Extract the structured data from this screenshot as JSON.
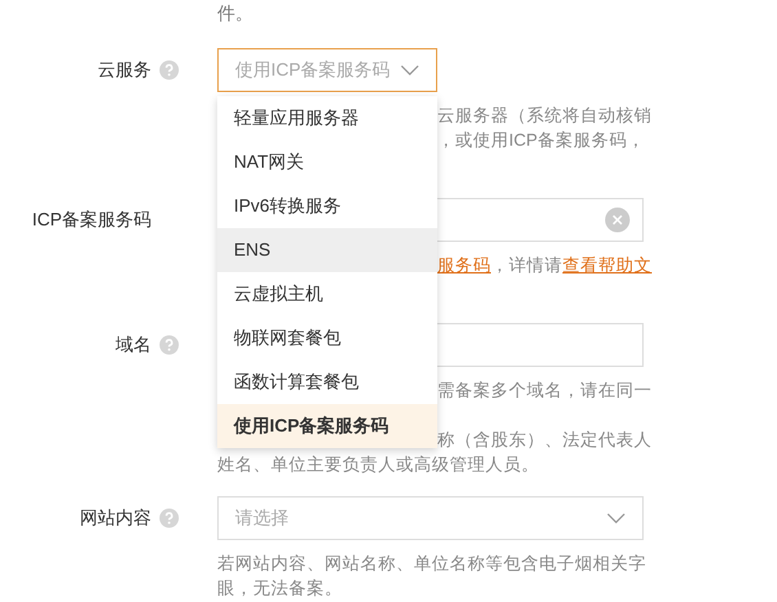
{
  "top_text": "件。",
  "fields": [
    {
      "label": "云服务",
      "help_icon": true,
      "kind": "select",
      "value": "使用ICP备案服务码",
      "open": true,
      "help_lines": [
        {
          "covered": true,
          "parts": [
            {
              "kind": "text",
              "text": "云服务器（系统将自动核销"
            }
          ]
        },
        {
          "covered": true,
          "parts": [
            {
              "kind": "text",
              "text": "，或使用ICP备案服务码，"
            }
          ]
        }
      ]
    },
    {
      "label": "ICP备案服务码",
      "help_icon": false,
      "kind": "input",
      "clearable": true,
      "help_lines": [
        {
          "covered": true,
          "parts": [
            {
              "kind": "link",
              "text": "服务码"
            },
            {
              "kind": "text",
              "text": "，详情请"
            },
            {
              "kind": "link",
              "text": "查看帮助文"
            }
          ]
        }
      ]
    },
    {
      "label": "域名",
      "help_icon": true,
      "kind": "input",
      "clearable": false,
      "help_lines": [
        {
          "covered": true,
          "parts": [
            {
              "kind": "text",
              "text": "需备案多个域名，请在同一"
            }
          ]
        },
        {
          "covered": true,
          "blank_before": true,
          "parts": [
            {
              "kind": "text",
              "text": "称（含股东）、法定代表人"
            }
          ]
        },
        {
          "parts": [
            {
              "kind": "text",
              "text": "姓名、单位主要负责人或高级管理人员。"
            }
          ]
        }
      ]
    },
    {
      "label": "网站内容",
      "help_icon": true,
      "kind": "select",
      "placeholder": "请选择",
      "open": false,
      "help_lines": [
        {
          "parts": [
            {
              "kind": "text",
              "text": "若网站内容、网站名称、单位名称等包含电子烟相关字"
            }
          ]
        },
        {
          "parts": [
            {
              "kind": "text",
              "text": "眼，无法备案。"
            }
          ]
        }
      ]
    }
  ],
  "dropdown": {
    "options": [
      {
        "label": "轻量应用服务器",
        "selected": false,
        "hovered": false
      },
      {
        "label": "NAT网关",
        "selected": false,
        "hovered": false
      },
      {
        "label": "IPv6转换服务",
        "selected": false,
        "hovered": false
      },
      {
        "label": "ENS",
        "selected": false,
        "hovered": true
      },
      {
        "label": "云虚拟主机",
        "selected": false,
        "hovered": false
      },
      {
        "label": "物联网套餐包",
        "selected": false,
        "hovered": false
      },
      {
        "label": "函数计算套餐包",
        "selected": false,
        "hovered": false
      },
      {
        "label": "使用ICP备案服务码",
        "selected": true,
        "hovered": false
      }
    ]
  }
}
